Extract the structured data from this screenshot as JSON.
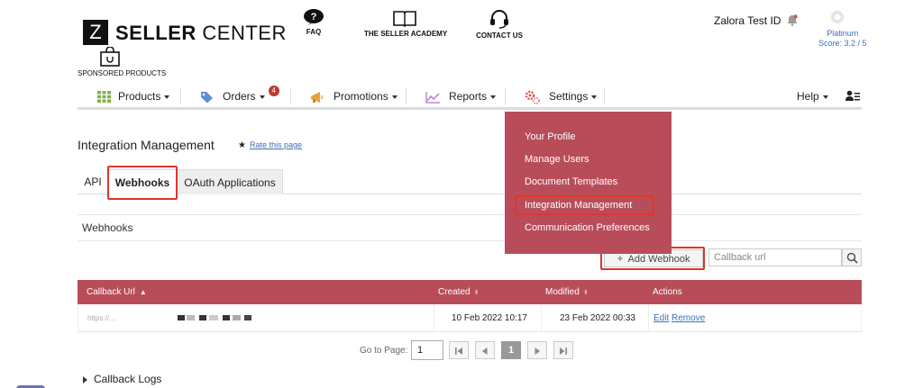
{
  "header": {
    "logo_letter": "Z",
    "logo_bold": "SELLER",
    "logo_rest": " CENTER",
    "links": [
      {
        "label": "FAQ",
        "icon": "question-icon"
      },
      {
        "label": "THE SELLER ACADEMY",
        "icon": "book-icon"
      },
      {
        "label": "CONTACT US",
        "icon": "headset-icon"
      }
    ],
    "sponsored_label": "SPONSORED PRODUCTS",
    "user_name": "Zalora Test ID",
    "tier": "Platinum",
    "score": "Score: 3.2 / 5"
  },
  "nav": {
    "items": [
      {
        "label": "Products",
        "icon": "grid-icon",
        "icon_color": "#7cb342"
      },
      {
        "label": "Orders",
        "icon": "tag-icon",
        "icon_color": "#5c8fd6",
        "badge": "4"
      },
      {
        "label": "Promotions",
        "icon": "megaphone-icon",
        "icon_color": "#e6a23c"
      },
      {
        "label": "Reports",
        "icon": "line-chart-icon",
        "icon_color": "#b58ad6"
      },
      {
        "label": "Settings",
        "icon": "gears-icon",
        "icon_color": "#d9534f"
      }
    ],
    "help_label": "Help"
  },
  "settings_menu": {
    "items": [
      "Your Profile",
      "Manage Users",
      "Document Templates",
      "Integration Management",
      "Communication Preferences"
    ],
    "highlighted": "Integration Management"
  },
  "page": {
    "title": "Integration Management",
    "rate_label": "Rate this page",
    "tabs": [
      "API",
      "Webhooks",
      "OAuth Applications"
    ],
    "active_tab": "Webhooks",
    "panel_title": "Webhooks",
    "add_button": "Add Webhook",
    "search_placeholder": "Callback url"
  },
  "table": {
    "headers": [
      "Callback Url",
      "Created",
      "Modified",
      "Actions"
    ],
    "rows": [
      {
        "callback_url": "https://…",
        "created": "10 Feb 2022 10:17",
        "modified": "23 Feb 2022 00:33",
        "edit": "Edit",
        "remove": "Remove"
      }
    ]
  },
  "pagination": {
    "goto_label": "Go to Page:",
    "page_value": "1",
    "current_page": "1"
  },
  "callback_logs": "Callback Logs",
  "colors": {
    "accent": "#b84d59",
    "highlight": "#e0352b",
    "link": "#3a6fb8"
  }
}
